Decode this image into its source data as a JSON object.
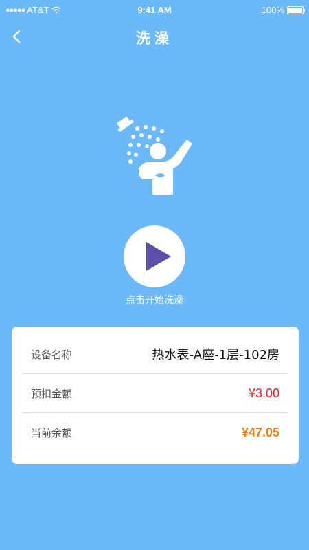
{
  "status_bar": {
    "carrier": "AT&T",
    "time": "9:41 AM",
    "battery": "100%",
    "battery_level": 1.0
  },
  "nav": {
    "title": "洗澡",
    "back_icon": "chevron-left-icon"
  },
  "shower": {
    "icon": "shower-person-icon",
    "play_icon": "play-icon",
    "hint": "点击开始洗澡"
  },
  "info": {
    "rows": [
      {
        "label": "设备名称",
        "value": "热水表-A座-1层-102房"
      },
      {
        "label": "预扣金额",
        "value": "¥3.00"
      },
      {
        "label": "当前余额",
        "value": "¥47.05"
      }
    ]
  },
  "colors": {
    "background": "#6bb8fb",
    "play": "#5b4fa8",
    "deduct": "#d3262c",
    "balance": "#e8811d"
  }
}
